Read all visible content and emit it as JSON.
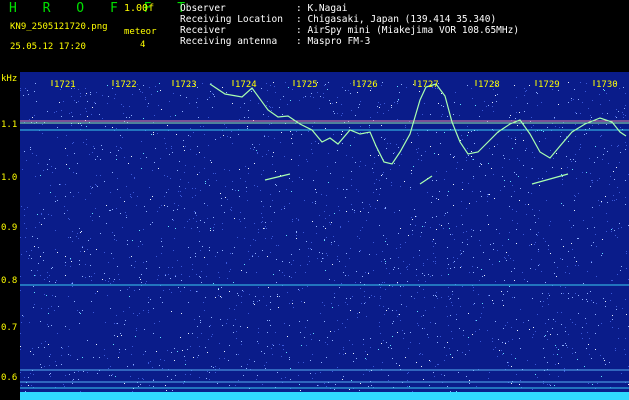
{
  "header": {
    "app_title": "H R O F F T",
    "version": "1.00f",
    "file_name": "KN9_2505121720.png",
    "meteor_label": "meteor",
    "meteor_count": "4",
    "date_time": "25.05.12 17:20"
  },
  "station_info": [
    {
      "key": "Observer",
      "value": ": K.Nagai"
    },
    {
      "key": "Receiving Location",
      "value": ": Chigasaki, Japan (139.414 35.340)"
    },
    {
      "key": "Receiver",
      "value": ": AirSpy mini (Miakejima VOR 108.65MHz)"
    },
    {
      "key": "Receiving antenna",
      "value": ": Maspro FM-3"
    }
  ],
  "y_axis": {
    "unit": "kHz",
    "ticks": [
      "1.1",
      "1.0",
      "0.9",
      "0.8",
      "0.7",
      "0.6"
    ]
  },
  "time_axis": {
    "ticks": [
      "1721",
      "1722",
      "1723",
      "1724",
      "1725",
      "1726",
      "1727",
      "1728",
      "1729",
      "1730"
    ]
  },
  "colors": {
    "background": "#000000",
    "plot_background": "#0a1c8a",
    "label_yellow": "#ffff00",
    "title_green": "#00e000",
    "carrier_line": "#40e0ff",
    "trace_green": "#a8ffb0"
  }
}
